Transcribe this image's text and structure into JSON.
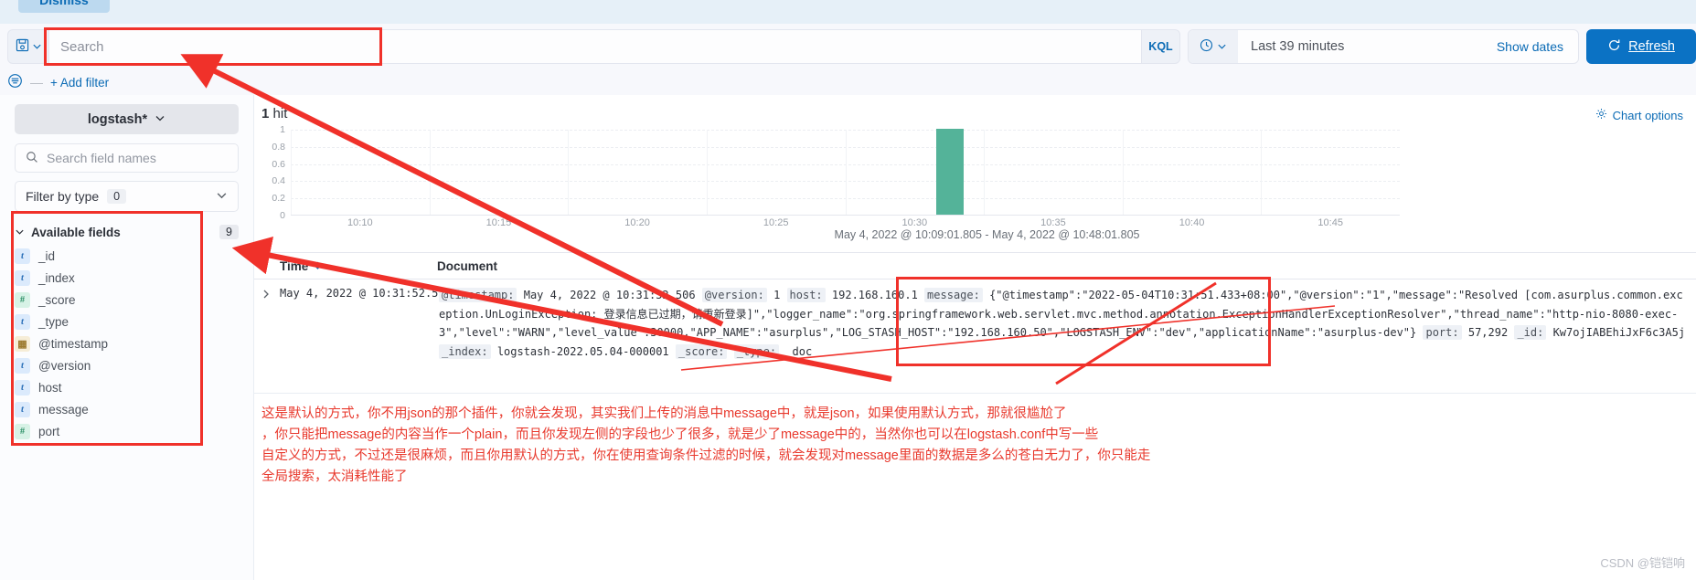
{
  "topbar": {
    "dismiss_label": "Dismiss"
  },
  "query": {
    "saved_query_icon": "save-icon",
    "chevron_icon": "chevron-down-icon",
    "search_placeholder": "Search",
    "kql_label": "KQL",
    "clock_icon": "clock-icon",
    "time_range": "Last 39 minutes",
    "show_dates_label": "Show dates",
    "refresh_icon": "refresh-icon",
    "refresh_label": "Refresh"
  },
  "filterbar": {
    "filter_icon": "filter-icon",
    "add_filter_label": "+ Add filter"
  },
  "sidebar": {
    "index_pattern": "logstash*",
    "index_chevron_icon": "chevron-down-icon",
    "more_icon": "grid-dots-icon",
    "collapse_icon": "collapse-panel-icon",
    "search_icon": "search-icon",
    "search_fields_placeholder": "Search field names",
    "filter_by_type_label": "Filter by type",
    "filter_by_type_count": "0",
    "filter_chevron_icon": "chevron-down-icon",
    "available_fields_label": "Available fields",
    "available_fields_count": "9",
    "available_chevron_icon": "chevron-down-icon",
    "fields": [
      {
        "name": "_id",
        "type": "t"
      },
      {
        "name": "_index",
        "type": "t"
      },
      {
        "name": "_score",
        "type": "#"
      },
      {
        "name": "_type",
        "type": "t"
      },
      {
        "name": "@timestamp",
        "type": "date"
      },
      {
        "name": "@version",
        "type": "t"
      },
      {
        "name": "host",
        "type": "t"
      },
      {
        "name": "message",
        "type": "t"
      },
      {
        "name": "port",
        "type": "#"
      }
    ]
  },
  "main": {
    "hit_count": "1",
    "hit_label": "hit",
    "chart_options_label": "Chart options",
    "chart_options_icon": "gear-icon",
    "time_range_caption": "May 4, 2022 @ 10:09:01.805 - May 4, 2022 @ 10:48:01.805",
    "columns": {
      "time": "Time",
      "sort_icon": "sort-desc-icon",
      "document": "Document"
    },
    "row": {
      "expander_icon": "chevron-right-icon",
      "time": "May 4, 2022 @ 10:31:52.506",
      "fields": [
        {
          "key": "@timestamp:",
          "value": "May 4, 2022 @ 10:31:52.506"
        },
        {
          "key": "@version:",
          "value": "1"
        },
        {
          "key": "host:",
          "value": "192.168.160.1"
        }
      ],
      "message_key": "message:",
      "message_value": "{\"@timestamp\":\"2022-05-04T10:31:51.433+08:00\",\"@version\":\"1\",\"message\":\"Resolved [com.asurplus.common.exception.UnLoginException: 登录信息已过期，请重新登录]\",\"logger_name\":\"org.springframework.web.servlet.mvc.method.annotation.ExceptionHandlerExceptionResolver\",\"thread_name\":\"http-nio-8080-exec-3\",\"level\":\"WARN\",\"level_value\":30000,\"APP_NAME\":\"asurplus\",\"LOG_STASH_HOST\":\"192.168.160.50\",\"LOGSTASH_ENV\":\"dev\",\"applicationName\":\"asurplus-dev\"}",
      "port_key": "port:",
      "port_value": "57,292",
      "meta": [
        {
          "key": "_id:",
          "value": "Kw7ojIABEhiJxF6c3A5j"
        },
        {
          "key": "_index:",
          "value": "logstash-2022.05.04-000001"
        },
        {
          "key": "_score:",
          "value": ""
        },
        {
          "key": "_type:",
          "value": "_doc"
        }
      ]
    }
  },
  "chart_data": {
    "type": "bar",
    "title": "",
    "xlabel": "",
    "ylabel": "",
    "ylim": [
      0,
      1
    ],
    "ytick_labels": [
      "1",
      "0.8",
      "0.6",
      "0.4",
      "0.2",
      "0"
    ],
    "xtick_labels": [
      "10:10",
      "10:15",
      "10:20",
      "10:25",
      "10:30",
      "10:35",
      "10:40",
      "10:45"
    ],
    "categories": [
      "10:31"
    ],
    "values": [
      1
    ],
    "bar_color": "#54b399",
    "grid": true,
    "legend": "none",
    "caption": "May 4, 2022 @ 10:09:01.805 - May 4, 2022 @ 10:48:01.805"
  },
  "annotation": {
    "lines": [
      "这是默认的方式，你不用json的那个插件，你就会发现，其实我们上传的消息中message中，就是json，如果使用默认方式，那就很尴尬了",
      "，你只能把message的内容当作一个plain，而且你发现左侧的字段也少了很多，就是少了message中的，当然你也可以在logstash.conf中写一些",
      "自定义的方式，不过还是很麻烦，而且你用默认的方式，你在使用查询条件过滤的时候，就会发现对message里面的数据是多么的苍白无力了，你只能走",
      "全局搜索，太消耗性能了"
    ]
  },
  "watermark": "CSDN @铠铠响",
  "colors": {
    "accent": "#0b72c4",
    "bar": "#54b399",
    "callout": "#f0312a",
    "annotation_text": "#e8392d"
  }
}
